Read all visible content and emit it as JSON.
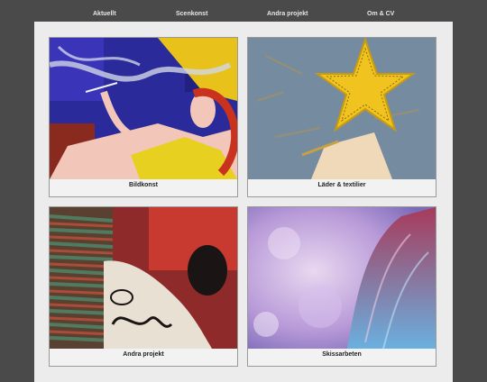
{
  "nav": {
    "items": [
      {
        "label": "Aktuellt"
      },
      {
        "label": "Scenkonst"
      },
      {
        "label": "Andra projekt"
      },
      {
        "label": "Om & CV"
      }
    ]
  },
  "gallery": {
    "cards": [
      {
        "caption": "Bildkonst"
      },
      {
        "caption": "Läder & textilier"
      },
      {
        "caption": "Andra projekt"
      },
      {
        "caption": "Skissarbeten"
      }
    ]
  },
  "colors": {
    "page_background": "#4a4a4a",
    "panel_background": "#ececec",
    "nav_text": "#e6e6e6"
  }
}
